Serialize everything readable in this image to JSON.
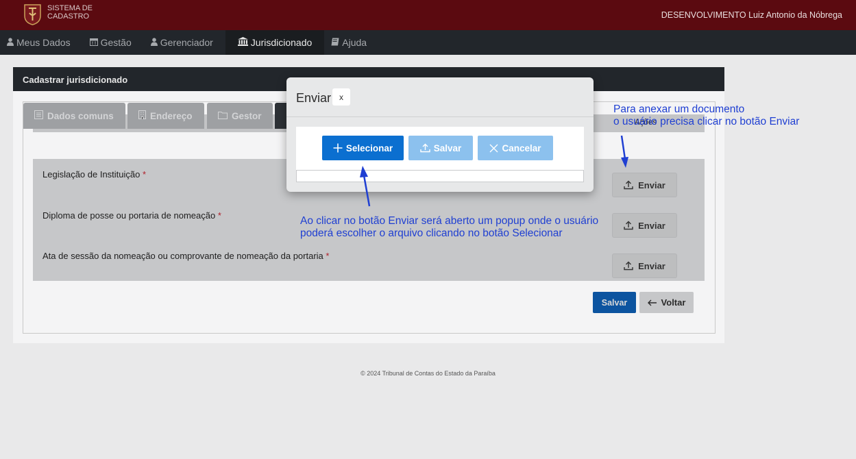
{
  "header": {
    "brand_line1": "SISTEMA DE",
    "brand_line2": "CADASTRO",
    "user_text": "DESENVOLVIMENTO Luiz Antonio da Nóbrega"
  },
  "nav": {
    "items": [
      {
        "label": "Meus Dados",
        "icon": "user-icon"
      },
      {
        "label": "Gestão",
        "icon": "calendar-icon"
      },
      {
        "label": "Gerenciador",
        "icon": "user-icon"
      },
      {
        "label": "Jurisdicionado",
        "icon": "bank-icon"
      },
      {
        "label": "Ajuda",
        "icon": "book-icon"
      }
    ],
    "active": "Jurisdicionado"
  },
  "card": {
    "title": "Cadastrar jurisdicionado",
    "tabs": [
      {
        "label": "Dados comuns",
        "icon": "list-icon"
      },
      {
        "label": "Endereço",
        "icon": "building-icon"
      },
      {
        "label": "Gestor",
        "icon": "folder-icon"
      }
    ],
    "table_header_actions": "Ações",
    "rows": [
      {
        "label": "Legislação de Instituição",
        "required": "*",
        "action": "Enviar"
      },
      {
        "label": "Diploma de posse ou portaria de nomeação",
        "required": "*",
        "action": "Enviar"
      },
      {
        "label": "Ata de sessão da nomeação ou comprovante de nomeação da portaria",
        "required": "*",
        "action": "Enviar"
      }
    ],
    "save_label": "Salvar",
    "back_label": "Voltar"
  },
  "footer": "© 2024 Tribunal de Contas do Estado da Paraíba",
  "modal": {
    "title": "Enviar",
    "close_label": "x",
    "select_label": "Selecionar",
    "save_label": "Salvar",
    "cancel_label": "Cancelar"
  },
  "annotations": {
    "note1_line1": "Para anexar um documento",
    "note1_line2": "o usuário precisa clicar no botão Enviar",
    "note2_line1": "Ao clicar no botão Enviar será aberto um popup onde o usuário",
    "note2_line2": "poderá escolher o arquivo clicando no botão Selecionar"
  },
  "colors": {
    "topbar": "#5b0a10",
    "nav": "#22262b",
    "primary": "#0b6fd0",
    "annotation": "#1f3fd2"
  }
}
